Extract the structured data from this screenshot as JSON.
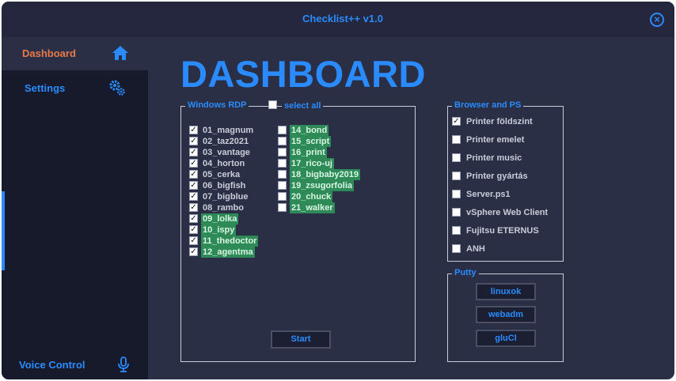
{
  "window": {
    "title": "Checklist++ v1.0"
  },
  "sidebar": {
    "items": [
      {
        "label": "Dashboard",
        "icon": "home-icon",
        "color": "#e87a4a"
      },
      {
        "label": "Settings",
        "icon": "gear-icon",
        "color": "#2a8bff"
      }
    ],
    "footer": {
      "label": "Voice Control",
      "icon": "microphone-icon"
    }
  },
  "main": {
    "title": "DASHBOARD"
  },
  "rdp": {
    "legend": "Windows RDP",
    "select_all_label": "select all",
    "select_all_checked": false,
    "col1": [
      {
        "label": "01_magnum",
        "checked": true,
        "highlight": false
      },
      {
        "label": "02_taz2021",
        "checked": true,
        "highlight": false
      },
      {
        "label": "03_vantage",
        "checked": true,
        "highlight": false
      },
      {
        "label": "04_horton",
        "checked": true,
        "highlight": false
      },
      {
        "label": "05_cerka",
        "checked": true,
        "highlight": false
      },
      {
        "label": "06_bigfish",
        "checked": true,
        "highlight": false
      },
      {
        "label": "07_bigblue",
        "checked": true,
        "highlight": false
      },
      {
        "label": "08_rambo",
        "checked": true,
        "highlight": false
      },
      {
        "label": "09_lolka",
        "checked": true,
        "highlight": true
      },
      {
        "label": "10_ispy",
        "checked": true,
        "highlight": true
      },
      {
        "label": "11_thedoctor",
        "checked": true,
        "highlight": true
      },
      {
        "label": "12_agentma",
        "checked": true,
        "highlight": true
      }
    ],
    "col2": [
      {
        "label": "14_bond",
        "checked": false,
        "highlight": true
      },
      {
        "label": "15_script",
        "checked": false,
        "highlight": true
      },
      {
        "label": "16_print",
        "checked": false,
        "highlight": true
      },
      {
        "label": "17_rico-uj",
        "checked": false,
        "highlight": true
      },
      {
        "label": "18_bigbaby2019",
        "checked": false,
        "highlight": true
      },
      {
        "label": "19_zsugorfolia",
        "checked": false,
        "highlight": true
      },
      {
        "label": "20_chuck",
        "checked": false,
        "highlight": true
      },
      {
        "label": "21_walker",
        "checked": false,
        "highlight": true
      }
    ],
    "start_label": "Start"
  },
  "browser": {
    "legend": "Browser and PS",
    "items": [
      {
        "label": "Printer földszint",
        "checked": true
      },
      {
        "label": "Printer emelet",
        "checked": false
      },
      {
        "label": "Printer music",
        "checked": false
      },
      {
        "label": "Printer gyártás",
        "checked": false
      },
      {
        "label": "Server.ps1",
        "checked": false
      },
      {
        "label": "vSphere Web Client",
        "checked": false
      },
      {
        "label": "Fujitsu ETERNUS",
        "checked": false
      },
      {
        "label": "ANH",
        "checked": false
      }
    ]
  },
  "putty": {
    "legend": "Putty",
    "buttons": [
      "linuxok",
      "webadm",
      "gluCl"
    ]
  },
  "colors": {
    "accent": "#2a8bff",
    "active_nav": "#e87a4a",
    "highlight": "#2e8b57",
    "window_bg": "#2b2f45",
    "sidebar_bg": "#171a2b"
  }
}
